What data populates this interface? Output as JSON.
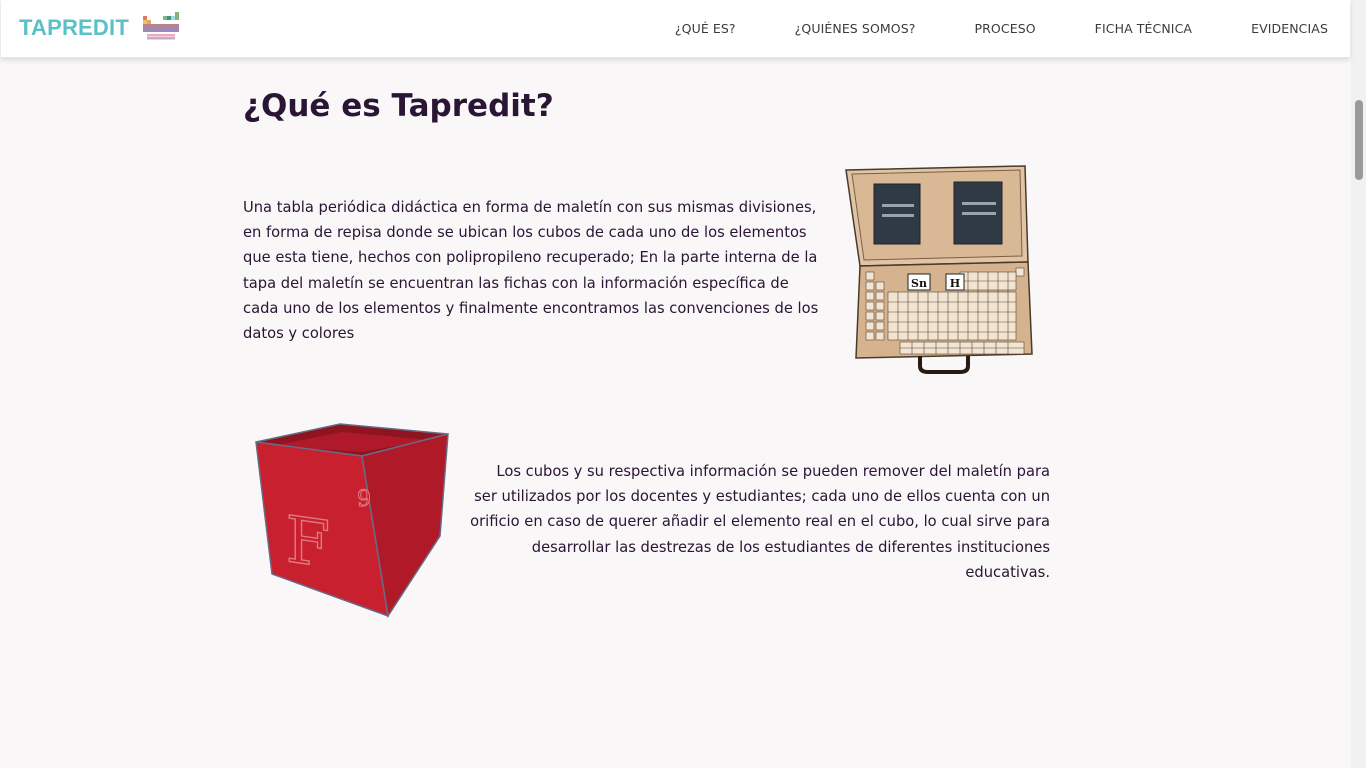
{
  "nav": {
    "brand": "TAPREDIT",
    "links": [
      "¿QUÉ ES?",
      "¿QUIÉNES SOMOS?",
      "PROCESO",
      "FICHA TÉCNICA",
      "EVIDENCIAS"
    ]
  },
  "section": {
    "title": "¿Qué es Tapredit?",
    "paragraph1": "Una tabla periódica didáctica en forma de maletín con sus mismas divisiones, en forma de repisa donde se ubican los cubos de cada uno de los elementos que esta tiene, hechos con polipropileno recuperado; En la parte interna de la tapa del maletín se encuentran las fichas con la información específica de cada uno de los elementos y finalmente encontramos las convenciones de los datos y colores",
    "paragraph2": "Los cubos y su respectiva información se pueden remover del maletín para ser utilizados por los docentes y estudiantes; cada uno de ellos cuenta con un orificio en caso de querer añadir el elemento real en el cubo, lo cual sirve para desarrollar las destrezas de los estudiantes de diferentes instituciones educativas."
  },
  "case_image": {
    "label_left": "Sn",
    "label_right": "H"
  },
  "cube_image": {
    "symbol": "F",
    "number": "9"
  },
  "colors": {
    "brand": "#5cc0c7",
    "text": "#2a1535",
    "background": "#f9f7f7",
    "cube": "#c8202e",
    "case": "#d9b896"
  }
}
